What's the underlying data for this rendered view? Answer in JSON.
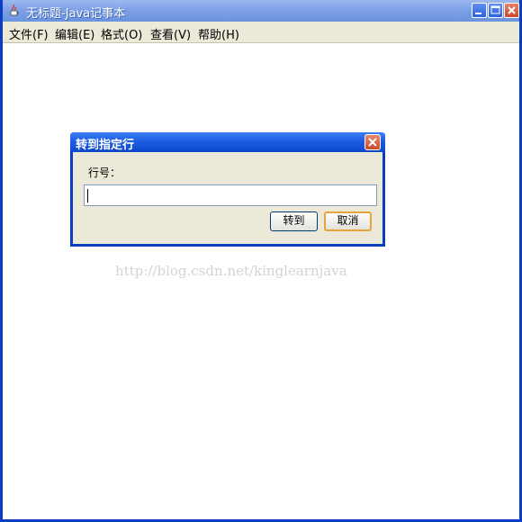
{
  "window": {
    "title": "无标题-Java记事本",
    "menu": [
      "文件(F)",
      "编辑(E)",
      "格式(O)",
      "查看(V)",
      "帮助(H)"
    ]
  },
  "dialog": {
    "title": "转到指定行",
    "field_label": "行号：",
    "line_value": "",
    "goto_label": "转到",
    "cancel_label": "取消"
  },
  "watermark": "http://blog.csdn.net/kinglearnjava",
  "icons": {
    "app": "java-cup-icon",
    "minimize": "minimize-icon",
    "maximize": "maximize-icon",
    "close": "close-icon",
    "dialog_close": "close-icon"
  },
  "colors": {
    "window_border": "#0a3cc4",
    "inactive_titlebar": "#7ea1e6",
    "dialog_titlebar": "#1f5fe3",
    "chrome_background": "#ece9d8",
    "default_button_border": "#e8a33c",
    "watermark": "#d3d3d3"
  }
}
